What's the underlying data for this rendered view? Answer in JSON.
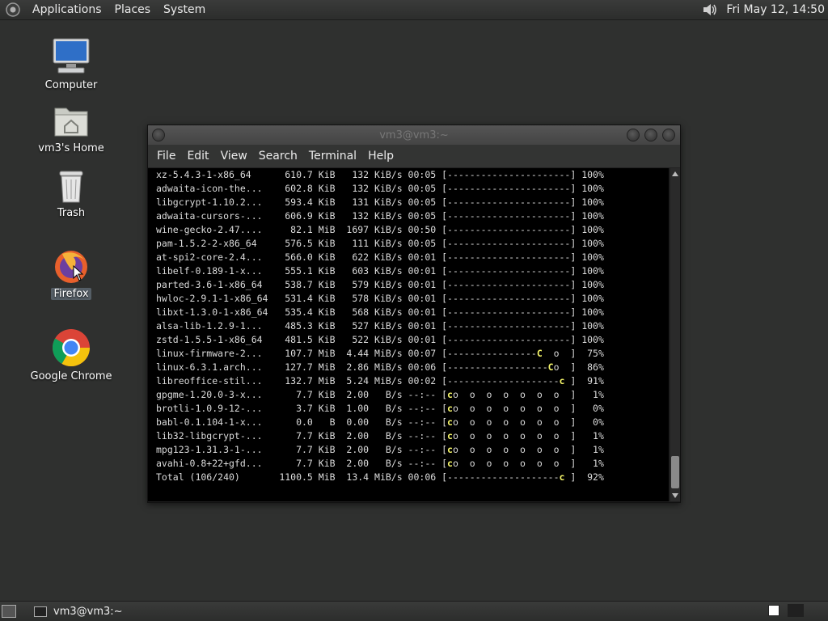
{
  "top_panel": {
    "menus": [
      "Applications",
      "Places",
      "System"
    ],
    "clock": "Fri May 12, 14:50"
  },
  "desktop": {
    "icons": [
      {
        "label": "Computer"
      },
      {
        "label": "vm3's Home"
      },
      {
        "label": "Trash"
      },
      {
        "label": "Firefox"
      },
      {
        "label": "Google Chrome"
      }
    ]
  },
  "window": {
    "title": "vm3@vm3:~",
    "menus": [
      "File",
      "Edit",
      "View",
      "Search",
      "Terminal",
      "Help"
    ],
    "lines": [
      "xz-5.4.3-1-x86_64      610.7 KiB   132 KiB/s 00:05 [----------------------] 100%",
      "adwaita-icon-the...    602.8 KiB   132 KiB/s 00:05 [----------------------] 100%",
      "libgcrypt-1.10.2...    593.4 KiB   131 KiB/s 00:05 [----------------------] 100%",
      "adwaita-cursors-...    606.9 KiB   132 KiB/s 00:05 [----------------------] 100%",
      "wine-gecko-2.47....     82.1 MiB  1697 KiB/s 00:50 [----------------------] 100%",
      "pam-1.5.2-2-x86_64     576.5 KiB   111 KiB/s 00:05 [----------------------] 100%",
      "at-spi2-core-2.4...    566.0 KiB   622 KiB/s 00:01 [----------------------] 100%",
      "libelf-0.189-1-x...    555.1 KiB   603 KiB/s 00:01 [----------------------] 100%",
      "parted-3.6-1-x86_64    538.7 KiB   579 KiB/s 00:01 [----------------------] 100%",
      "hwloc-2.9.1-1-x86_64   531.4 KiB   578 KiB/s 00:01 [----------------------] 100%",
      "libxt-1.3.0-1-x86_64   535.4 KiB   568 KiB/s 00:01 [----------------------] 100%",
      "alsa-lib-1.2.9-1...    485.3 KiB   527 KiB/s 00:01 [----------------------] 100%",
      "zstd-1.5.5-1-x86_64    481.5 KiB   522 KiB/s 00:01 [----------------------] 100%",
      "linux-firmware-2...    107.7 MiB  4.44 MiB/s 00:07 [----------------C  o  ]  75%",
      "linux-6.3.1.arch...    127.7 MiB  2.86 MiB/s 00:06 [------------------Co  ]  86%",
      "libreoffice-stil...    132.7 MiB  5.24 MiB/s 00:02 [--------------------c ]  91%",
      "gpgme-1.20.0-3-x...      7.7 KiB  2.00   B/s --:-- [co  o  o  o  o  o  o  ]   1%",
      "brotli-1.0.9-12-...      3.7 KiB  1.00   B/s --:-- [co  o  o  o  o  o  o  ]   0%",
      "babl-0.1.104-1-x...      0.0   B  0.00   B/s --:-- [co  o  o  o  o  o  o  ]   0%",
      "lib32-libgcrypt-...      7.7 KiB  2.00   B/s --:-- [co  o  o  o  o  o  o  ]   1%",
      "mpg123-1.31.3-1-...      7.7 KiB  2.00   B/s --:-- [co  o  o  o  o  o  o  ]   1%",
      "avahi-0.8+22+gfd...      7.7 KiB  2.00   B/s --:-- [co  o  o  o  o  o  o  ]   1%",
      "Total (106/240)       1100.5 MiB  13.4 MiB/s 00:06 [--------------------c ]  92%"
    ]
  },
  "taskbar": {
    "task_label": "vm3@vm3:~"
  },
  "colors": {
    "pacman": "#f7f76a",
    "desktop_bg": "#2f302f"
  }
}
